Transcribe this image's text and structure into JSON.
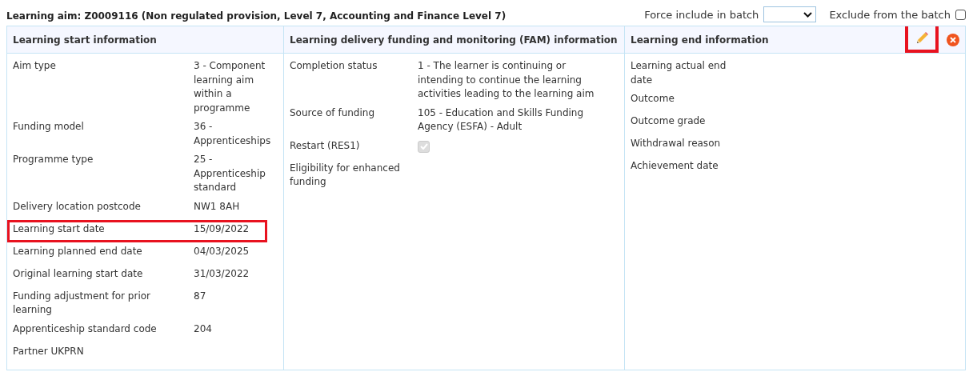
{
  "aim": {
    "title": "Learning aim: Z0009116 (Non regulated provision, Level 7, Accounting and Finance Level 7)"
  },
  "batch": {
    "force_label": "Force include in batch",
    "exclude_label": "Exclude from the batch",
    "exclude_checked": false
  },
  "sections": [
    {
      "title": "Learning start information",
      "rows": [
        {
          "kind": "text",
          "label": "Aim type",
          "value": "3 - Component learning aim within a programme",
          "highlighted": false
        },
        {
          "kind": "text",
          "label": "Funding model",
          "value": "36 - Apprenticeships",
          "highlighted": false
        },
        {
          "kind": "text",
          "label": "Programme type",
          "value": "25 - Apprenticeship standard",
          "highlighted": false
        },
        {
          "kind": "text",
          "label": "Delivery location postcode",
          "value": "NW1 8AH",
          "highlighted": false
        },
        {
          "kind": "text",
          "label": "Learning start date",
          "value": "15/09/2022",
          "highlighted": true
        },
        {
          "kind": "text",
          "label": "Learning planned end date",
          "value": "04/03/2025",
          "highlighted": false
        },
        {
          "kind": "text",
          "label": "Original learning start date",
          "value": "31/03/2022",
          "highlighted": false
        },
        {
          "kind": "text",
          "label": "Funding adjustment for prior learning",
          "value": "87",
          "highlighted": false
        },
        {
          "kind": "text",
          "label": "Apprenticeship standard code",
          "value": "204",
          "highlighted": false
        },
        {
          "kind": "text",
          "label": "Partner UKPRN",
          "highlighted": false
        }
      ]
    },
    {
      "title": "Learning delivery funding and monitoring (FAM) information",
      "rows": [
        {
          "kind": "text",
          "label": "Completion status",
          "value": "1 - The learner is continuing or intending to continue the learning activities leading to the learning aim",
          "highlighted": false
        },
        {
          "kind": "text",
          "label": "Source of funding",
          "value": "105 - Education and Skills Funding Agency (ESFA) - Adult",
          "highlighted": false
        },
        {
          "kind": "checkbox",
          "label": "Restart (RES1)",
          "checked": true,
          "highlighted": false
        },
        {
          "kind": "text",
          "label": "Eligibility for enhanced funding",
          "highlighted": false
        }
      ]
    },
    {
      "title": "Learning end information",
      "actions": true,
      "edit_highlighted": true,
      "rows": [
        {
          "kind": "text",
          "label": "Learning actual end date",
          "highlighted": false
        },
        {
          "kind": "text",
          "label": "Outcome",
          "highlighted": false
        },
        {
          "kind": "text",
          "label": "Outcome grade",
          "highlighted": false
        },
        {
          "kind": "text",
          "label": "Withdrawal reason",
          "highlighted": false
        },
        {
          "kind": "text",
          "label": "Achievement date",
          "highlighted": false
        }
      ]
    }
  ]
}
